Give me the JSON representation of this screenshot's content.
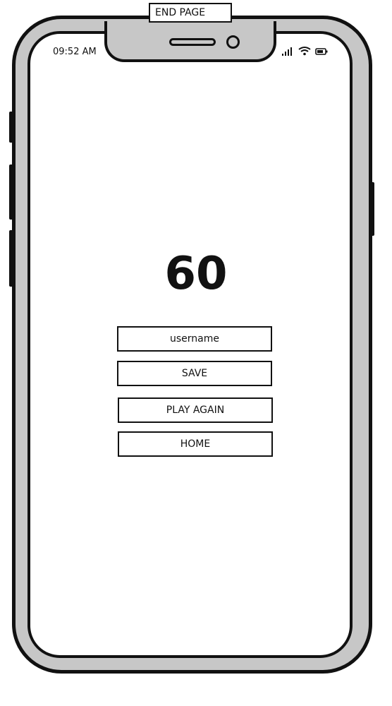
{
  "page_label": "END PAGE",
  "status_bar": {
    "time": "09:52 AM",
    "icons": [
      "signal-icon",
      "wifi-icon",
      "battery-icon"
    ]
  },
  "score": "60",
  "form": {
    "username_placeholder": "username",
    "username_value": ""
  },
  "buttons": {
    "save": "SAVE",
    "play_again": "PLAY AGAIN",
    "home": "HOME"
  },
  "colors": {
    "frame": "#c7c7c7",
    "outline": "#111111",
    "screen": "#ffffff"
  }
}
